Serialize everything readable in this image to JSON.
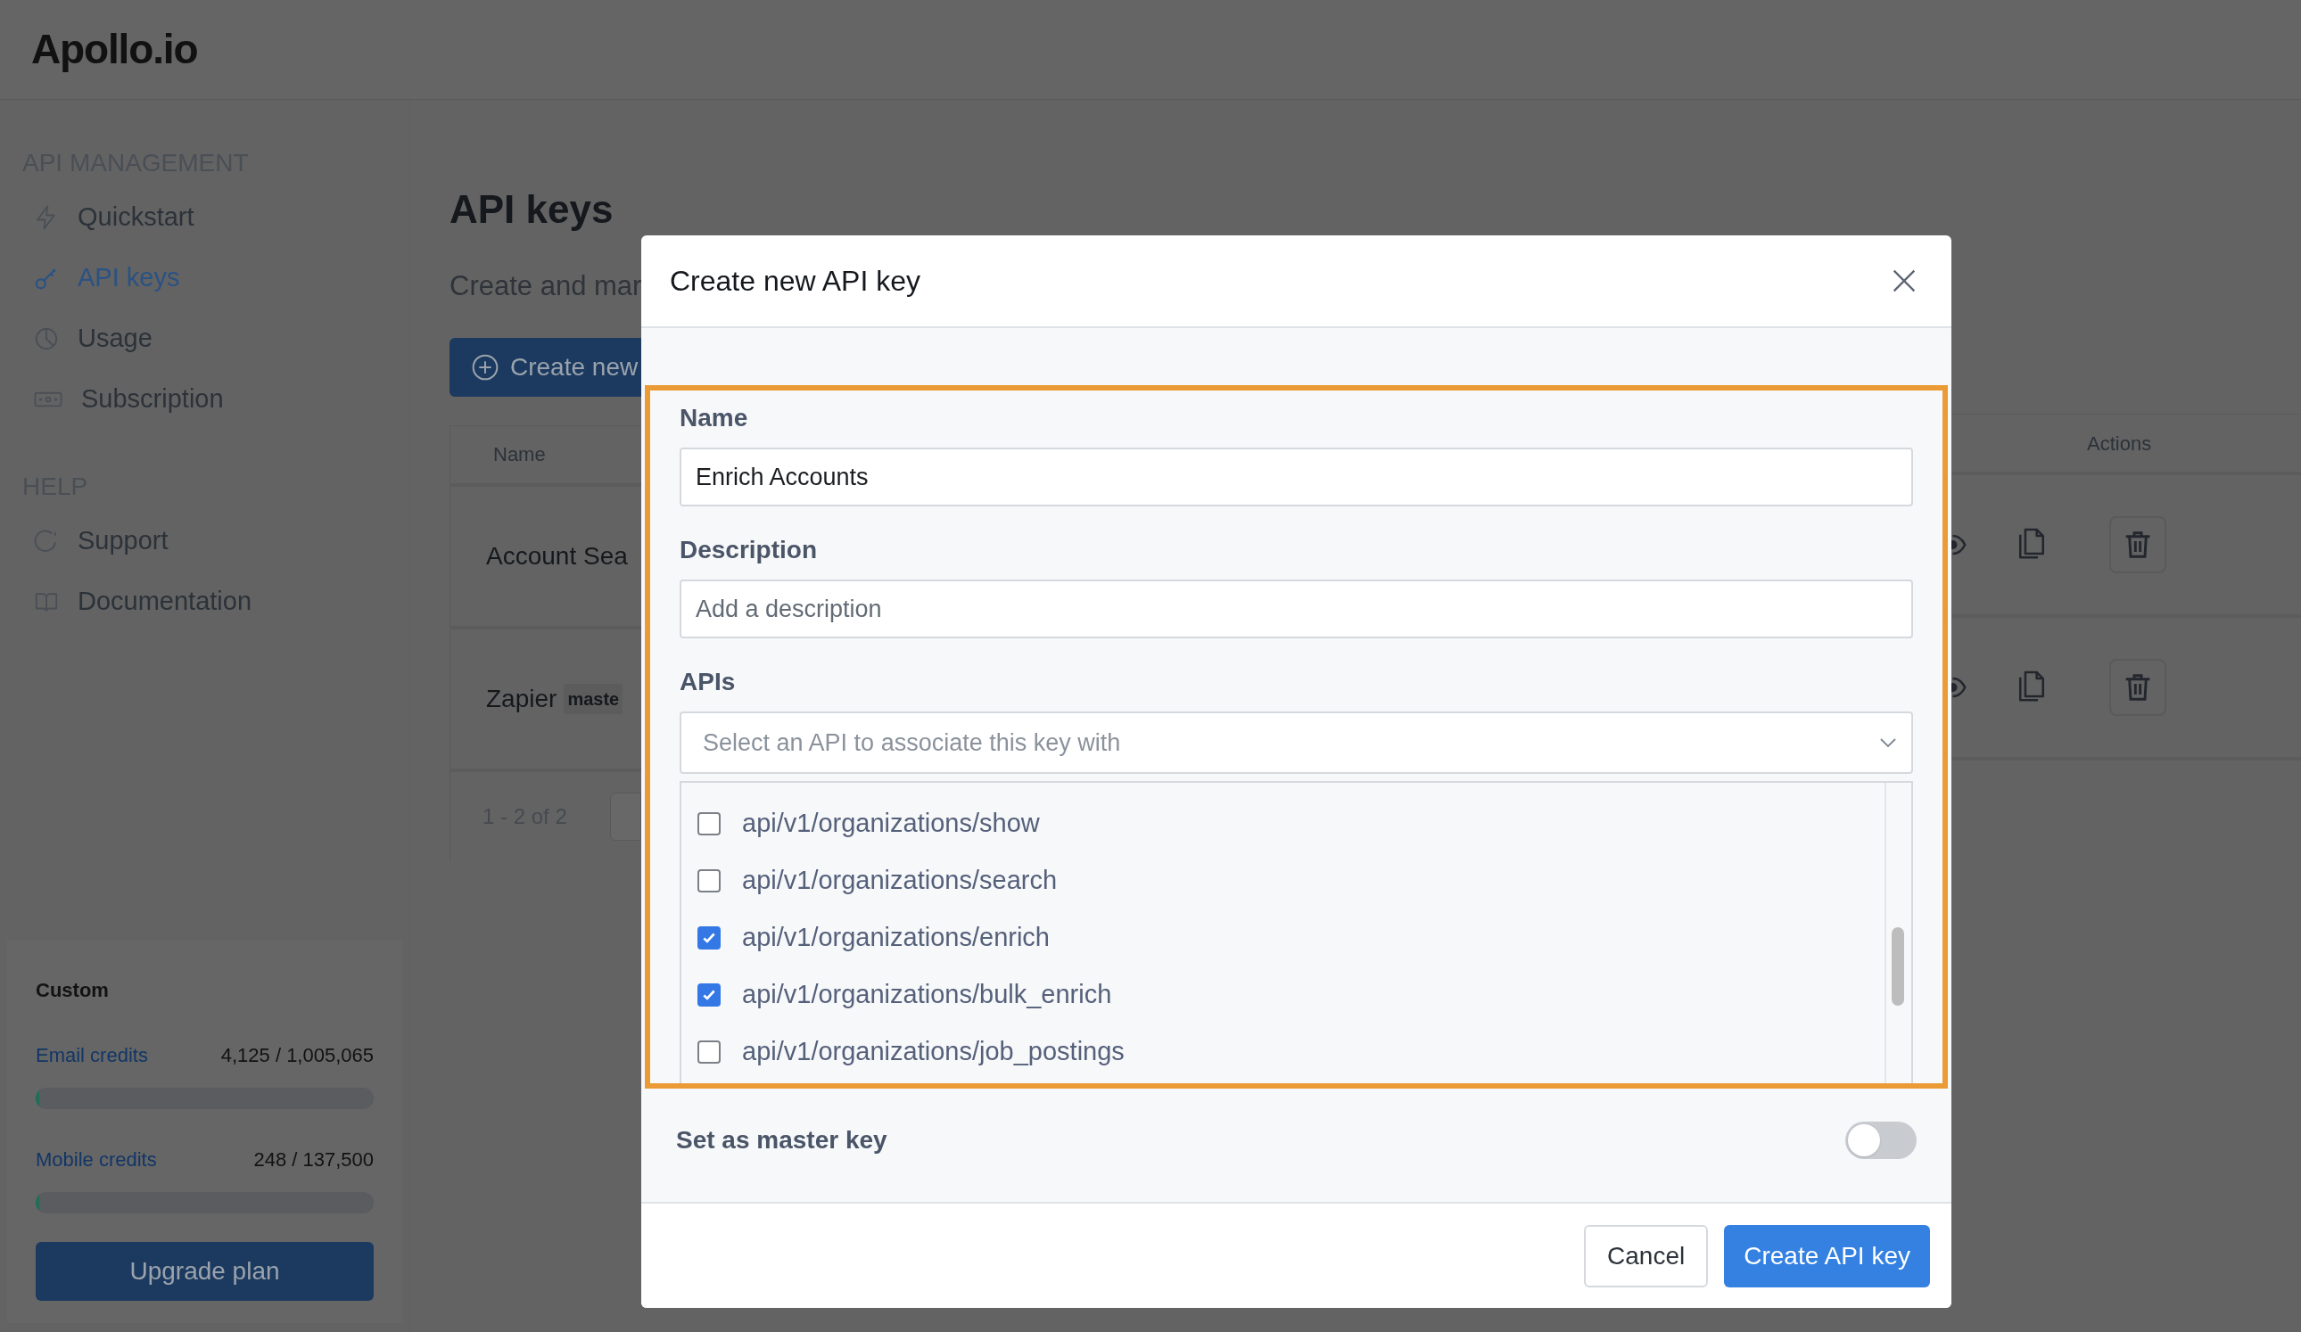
{
  "logo": {
    "text": "Apollo.io"
  },
  "sidebar": {
    "sections": [
      {
        "heading": "API MANAGEMENT",
        "items": [
          {
            "label": "Quickstart",
            "selected": false
          },
          {
            "label": "API keys",
            "selected": true
          },
          {
            "label": "Usage",
            "selected": false
          },
          {
            "label": "Subscription",
            "selected": false
          }
        ]
      },
      {
        "heading": "HELP",
        "items": [
          {
            "label": "Support",
            "selected": false
          },
          {
            "label": "Documentation",
            "selected": false
          }
        ]
      }
    ]
  },
  "plan": {
    "name": "Custom",
    "credits": [
      {
        "label": "Email credits",
        "reading": "4,125 / 1,005,065",
        "level": 0.01
      },
      {
        "label": "Mobile credits",
        "reading": "248 / 137,500",
        "level": 0.01
      }
    ],
    "button": "Upgrade plan"
  },
  "page": {
    "title": "API keys",
    "subtitle": "Create and mar",
    "create_button": "Create new",
    "table": {
      "columns": [
        "Name",
        "Actions"
      ],
      "rows": [
        {
          "name": "Account Sea"
        },
        {
          "name": "Zapier",
          "badge": "maste"
        }
      ],
      "pagination": "1 - 2 of 2"
    }
  },
  "modal": {
    "title": "Create new API key",
    "fields": [
      {
        "label": "Name",
        "value": "Enrich Accounts"
      },
      {
        "label": "Description",
        "placeholder": "Add a description"
      }
    ],
    "apis": {
      "label": "APIs",
      "placeholder": "Select an API to associate this key with",
      "options": [
        {
          "label": "api/v1/organizations/show",
          "checked": false
        },
        {
          "label": "api/v1/organizations/search",
          "checked": false
        },
        {
          "label": "api/v1/organizations/enrich",
          "checked": true
        },
        {
          "label": "api/v1/organizations/bulk_enrich",
          "checked": true
        },
        {
          "label": "api/v1/organizations/job_postings",
          "checked": false
        }
      ]
    },
    "master_key": {
      "label": "Set as master key",
      "on": false
    },
    "buttons": [
      {
        "label": "Cancel",
        "kind": "secondary"
      },
      {
        "label": "Create API key",
        "kind": "primary"
      }
    ]
  }
}
